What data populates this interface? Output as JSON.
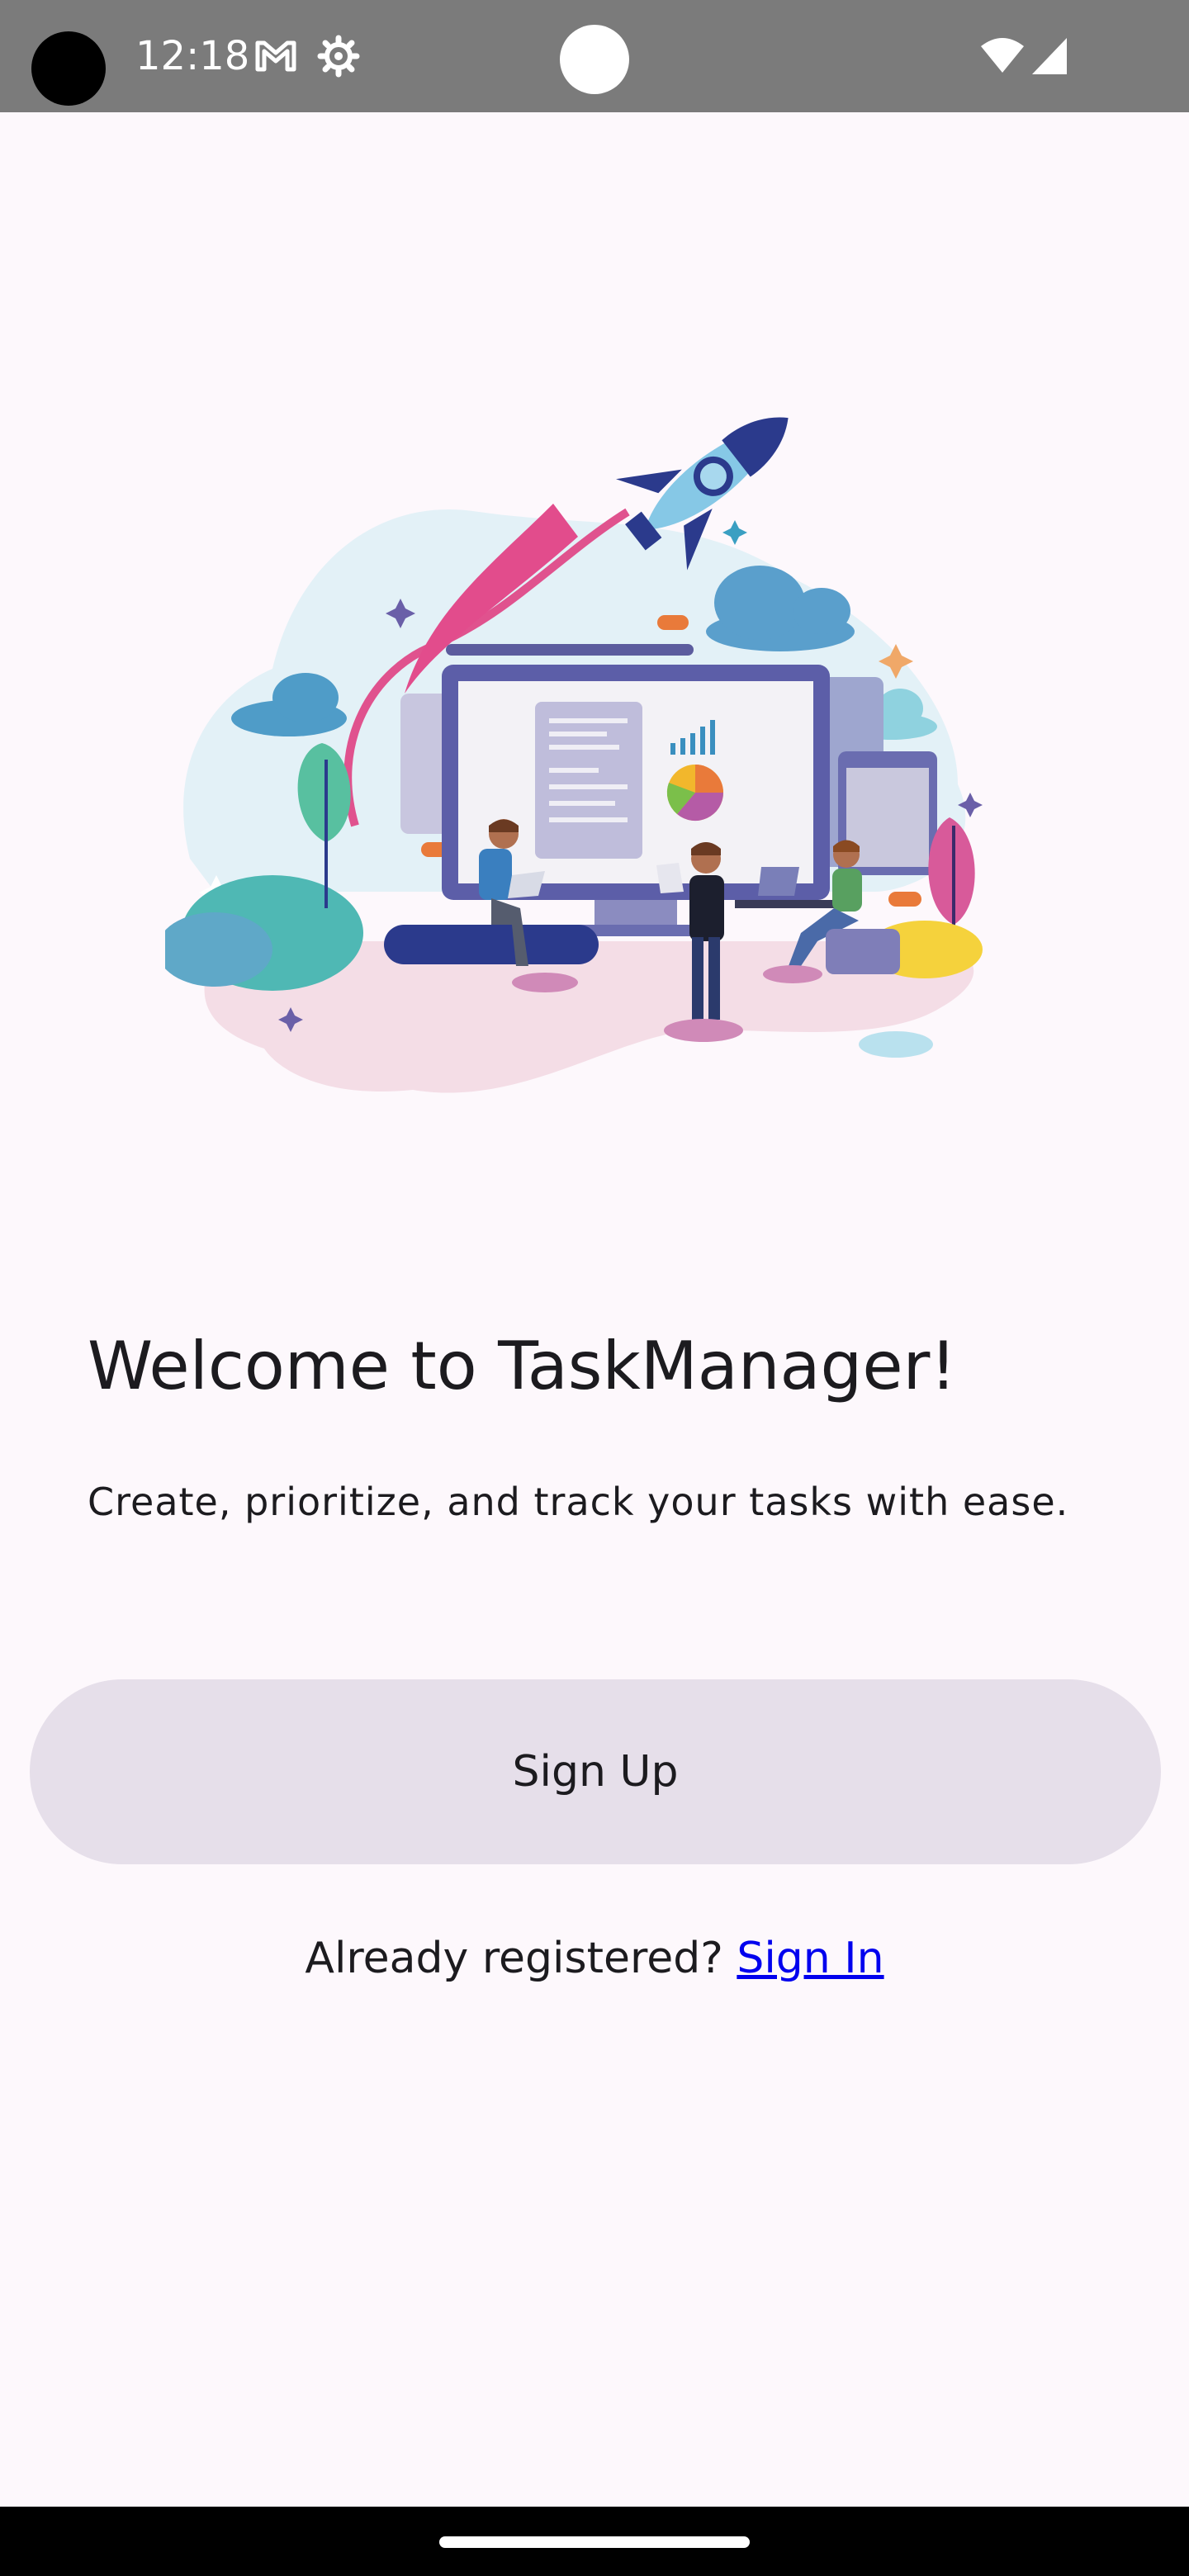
{
  "status_bar": {
    "time": "12:18",
    "icons": [
      "gmail-icon",
      "settings-icon",
      "wifi-icon",
      "signal-icon"
    ],
    "background": "#7b7b7b"
  },
  "hero": {
    "illustration": "rocket-launch-team-illustration"
  },
  "welcome": {
    "title": "Welcome to TaskManager!",
    "subtitle": "Create, prioritize, and track your tasks with ease."
  },
  "actions": {
    "signup_label": "Sign Up",
    "signin_prompt": "Already registered?",
    "signin_label": "Sign In"
  },
  "colors": {
    "background": "#fdf8fc",
    "button": "#e6dfea",
    "link": "#0000ee"
  }
}
